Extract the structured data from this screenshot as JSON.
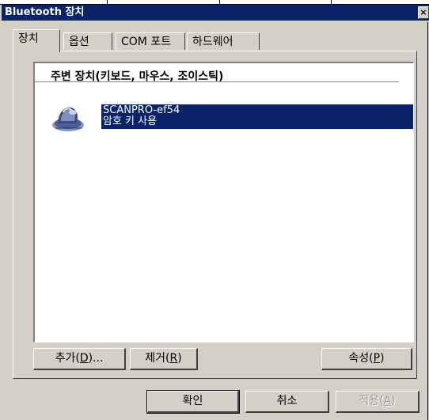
{
  "window": {
    "title": "Bluetooth 장치",
    "close_glyph": "×"
  },
  "tabs": [
    {
      "label": "장치",
      "active": true
    },
    {
      "label": "옵션",
      "active": false
    },
    {
      "label": "COM 포트",
      "active": false
    },
    {
      "label": "하드웨어",
      "active": false
    }
  ],
  "list": {
    "group_header": "주변 장치(키보드, 마우스, 조이스틱)",
    "devices": [
      {
        "name": "SCANPRO-ef54",
        "status": "암호 키 사용",
        "icon": "bluetooth-mouse-icon",
        "selected": true
      }
    ]
  },
  "panel_buttons": {
    "add": {
      "text": "추가(",
      "key": "D",
      "suffix": ")..."
    },
    "remove": {
      "text": "제거(",
      "key": "R",
      "suffix": ")"
    },
    "properties": {
      "text": "속성(",
      "key": "P",
      "suffix": ")"
    }
  },
  "dialog_buttons": {
    "ok": "확인",
    "cancel": "취소",
    "apply": {
      "text": "적용(",
      "key": "A",
      "suffix": ")",
      "enabled": false
    }
  },
  "colors": {
    "titlebar": "#0a246a",
    "selection": "#0a246a",
    "face": "#d4d0c8"
  }
}
